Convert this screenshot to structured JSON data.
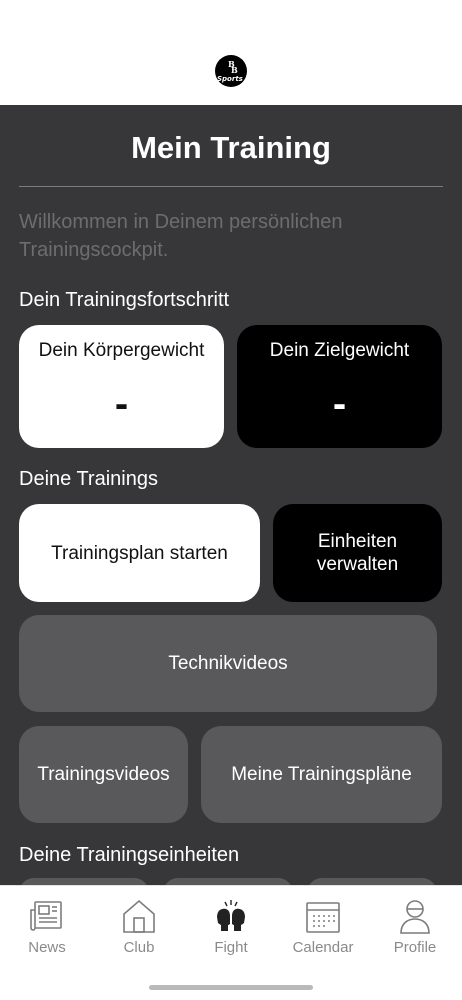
{
  "header": {
    "logo_alt": "BB Sports logo",
    "logo_text": "Sports"
  },
  "page": {
    "title": "Mein Training",
    "intro": "Willkommen in Deinem persönlichen Trainingscockpit."
  },
  "progress": {
    "section_label": "Dein Trainingsfortschritt",
    "body_weight": {
      "label": "Dein Körpergewicht",
      "value": "-"
    },
    "target_weight": {
      "label": "Dein Zielgewicht",
      "value": "-"
    }
  },
  "trainings": {
    "section_label": "Deine Trainings",
    "start_plan": "Trainingsplan starten",
    "manage_units": "Einheiten verwalten",
    "technique_videos": "Technikvideos",
    "training_videos": "Trainingsvideos",
    "my_plans": "Meine Trainingspläne"
  },
  "units": {
    "section_label": "Deine Trainingseinheiten"
  },
  "nav": {
    "items": [
      {
        "label": "News",
        "icon": "newspaper-icon"
      },
      {
        "label": "Club",
        "icon": "home-icon"
      },
      {
        "label": "Fight",
        "icon": "boxing-gloves-icon"
      },
      {
        "label": "Calendar",
        "icon": "calendar-icon"
      },
      {
        "label": "Profile",
        "icon": "profile-icon"
      }
    ]
  },
  "colors": {
    "main_bg": "#373639",
    "card_grey": "#59585b",
    "card_black": "#000000",
    "card_white": "#ffffff",
    "nav_label": "#8a8a8a"
  }
}
